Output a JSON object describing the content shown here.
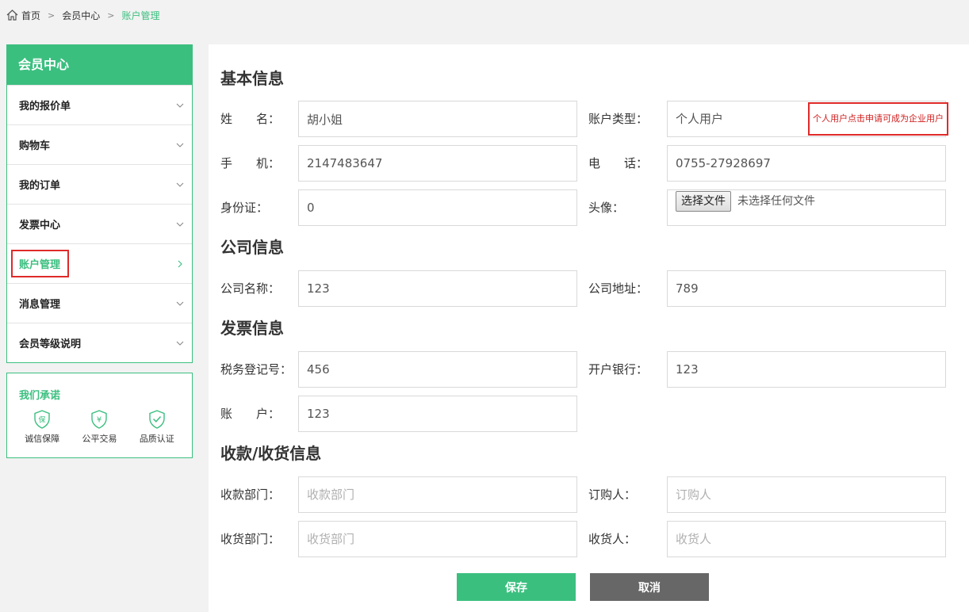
{
  "breadcrumb": {
    "home": "首页",
    "member_center": "会员中心",
    "current": "账户管理"
  },
  "sidebar": {
    "title": "会员中心",
    "items": [
      {
        "label": "我的报价单"
      },
      {
        "label": "购物车"
      },
      {
        "label": "我的订单"
      },
      {
        "label": "发票中心"
      },
      {
        "label": "账户管理",
        "active": true
      },
      {
        "label": "消息管理"
      },
      {
        "label": "会员等级说明"
      }
    ],
    "promise": {
      "title": "我们承诺",
      "items": [
        {
          "label": "诚信保障",
          "icon": "shield-bao-icon"
        },
        {
          "label": "公平交易",
          "icon": "shield-yen-icon"
        },
        {
          "label": "品质认证",
          "icon": "shield-check-icon"
        }
      ]
    }
  },
  "main": {
    "basic": {
      "title": "基本信息",
      "name_label": "姓　　名：",
      "name_value": "胡小姐",
      "account_type_label": "账户类型：",
      "account_type_value": "个人用户",
      "account_type_note": "个人用户点击申请可成为企业用户",
      "mobile_label": "手　　机：",
      "mobile_value": "2147483647",
      "phone_label": "电　　话：",
      "phone_value": "0755-27928697",
      "id_label": "身份证：",
      "id_value": "0",
      "avatar_label": "头像：",
      "file_button": "选择文件",
      "file_status": "未选择任何文件"
    },
    "company": {
      "title": "公司信息",
      "name_label": "公司名称：",
      "name_value": "123",
      "address_label": "公司地址：",
      "address_value": "789"
    },
    "invoice": {
      "title": "发票信息",
      "tax_label": "税务登记号：",
      "tax_value": "456",
      "bank_label": "开户银行：",
      "bank_value": "123",
      "account_label": "账　　户：",
      "account_value": "123"
    },
    "receipt": {
      "title": "收款/收货信息",
      "pay_dept_label": "收款部门：",
      "pay_dept_placeholder": "收款部门",
      "orderer_label": "订购人：",
      "orderer_placeholder": "订购人",
      "recv_dept_label": "收货部门：",
      "recv_dept_placeholder": "收货部门",
      "receiver_label": "收货人：",
      "receiver_placeholder": "收货人"
    },
    "buttons": {
      "save": "保存",
      "cancel": "取消"
    }
  },
  "colors": {
    "accent": "#3bbf7f",
    "highlight_border": "#e02a2a",
    "cancel_button": "#676767"
  }
}
